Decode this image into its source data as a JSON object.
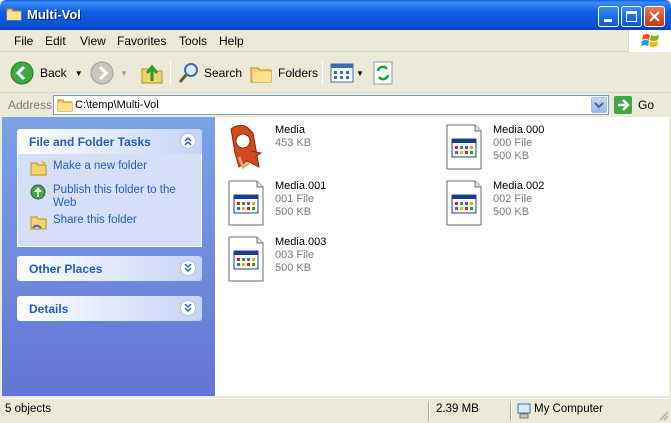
{
  "window": {
    "title": "Multi-Vol"
  },
  "menu": [
    "File",
    "Edit",
    "View",
    "Favorites",
    "Tools",
    "Help"
  ],
  "toolbar": {
    "back": "Back",
    "search": "Search",
    "folders": "Folders"
  },
  "address": {
    "label": "Address",
    "path": "C:\\temp\\Multi-Vol",
    "go": "Go"
  },
  "tasks": {
    "title": "File and Folder Tasks",
    "items": [
      "Make a new folder",
      "Publish this folder to the Web",
      "Share this folder"
    ]
  },
  "other_places": {
    "title": "Other Places"
  },
  "details": {
    "title": "Details"
  },
  "files": [
    {
      "name": "Media",
      "type": "",
      "size": "453 KB",
      "icon": "application-icon"
    },
    {
      "name": "Media.000",
      "type": "000 File",
      "size": "500 KB",
      "icon": "generic-file-icon"
    },
    {
      "name": "Media.001",
      "type": "001 File",
      "size": "500 KB",
      "icon": "generic-file-icon"
    },
    {
      "name": "Media.002",
      "type": "002 File",
      "size": "500 KB",
      "icon": "generic-file-icon"
    },
    {
      "name": "Media.003",
      "type": "003 File",
      "size": "500 KB",
      "icon": "generic-file-icon"
    }
  ],
  "status": {
    "objects": "5 objects",
    "size": "2.39 MB",
    "location": "My Computer"
  }
}
